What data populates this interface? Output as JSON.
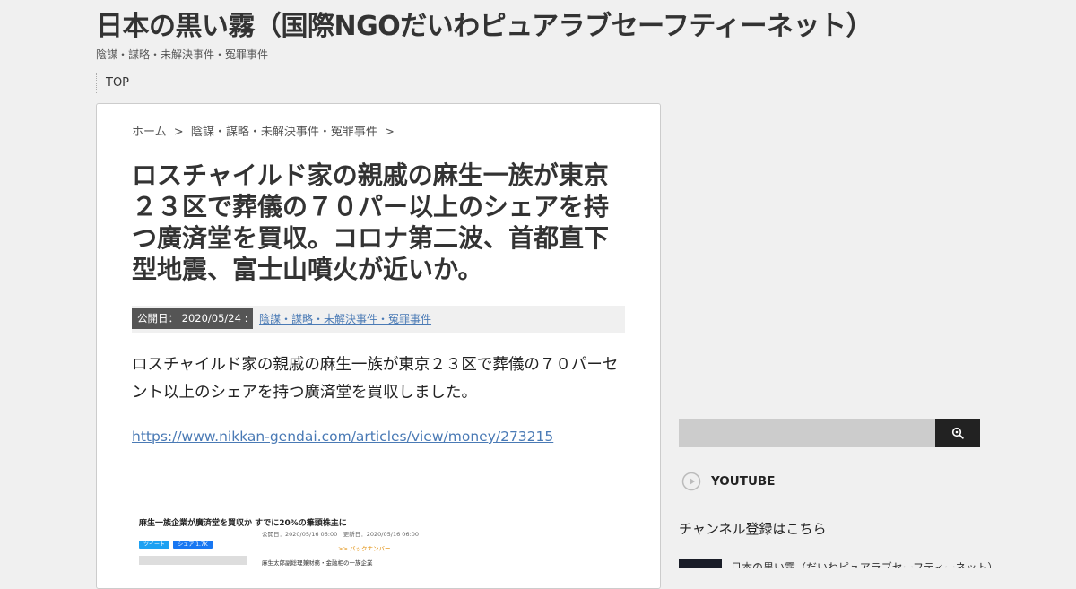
{
  "site": {
    "title": "日本の黒い霧（国際NGOだいわピュアラブセーフティーネット）",
    "description": "陰謀・謀略・未解決事件・冤罪事件"
  },
  "nav": {
    "items": [
      {
        "label": "TOP"
      }
    ]
  },
  "breadcrumb": {
    "home": "ホーム",
    "separator": ">",
    "category": "陰謀・謀略・未解決事件・冤罪事件"
  },
  "post": {
    "title": "ロスチャイルド家の親戚の麻生一族が東京２３区で葬儀の７０パー以上のシェアを持つ廣済堂を買収。コロナ第二波、首都直下型地震、富士山噴火が近いか。",
    "date_label": "公開日：",
    "date": "2020/05/24 :",
    "category": "陰謀・謀略・未解決事件・冤罪事件",
    "body": "ロスチャイルド家の親戚の麻生一族が東京２３区で葬儀の７０パーセント以上のシェアを持つ廣済堂を買収しました。",
    "link": "https://www.nikkan-gendai.com/articles/view/money/273215"
  },
  "embedded_image": {
    "headline": "麻生一族企業が廣済堂を買収か すでに20%の筆頭株主に",
    "published": "公開日：2020/05/16 06:00　更新日：2020/05/16 06:00",
    "tweet": "ツイート",
    "share": "シェア 1.7K",
    "back_number": ">> バックナンバー",
    "caption": "麻生太郎副総理兼財務・金融相の一族企業"
  },
  "sidebar": {
    "search": {
      "placeholder": ""
    },
    "youtube_heading": "YOUTUBE",
    "channel_text": "チャンネル登録はこちら",
    "video_title": "日本の黒い霧（だいわピュアラブセーフティーネット）"
  },
  "colors": {
    "link": "#4a7ab5",
    "date_badge": "#555555",
    "search_button": "#222222"
  }
}
